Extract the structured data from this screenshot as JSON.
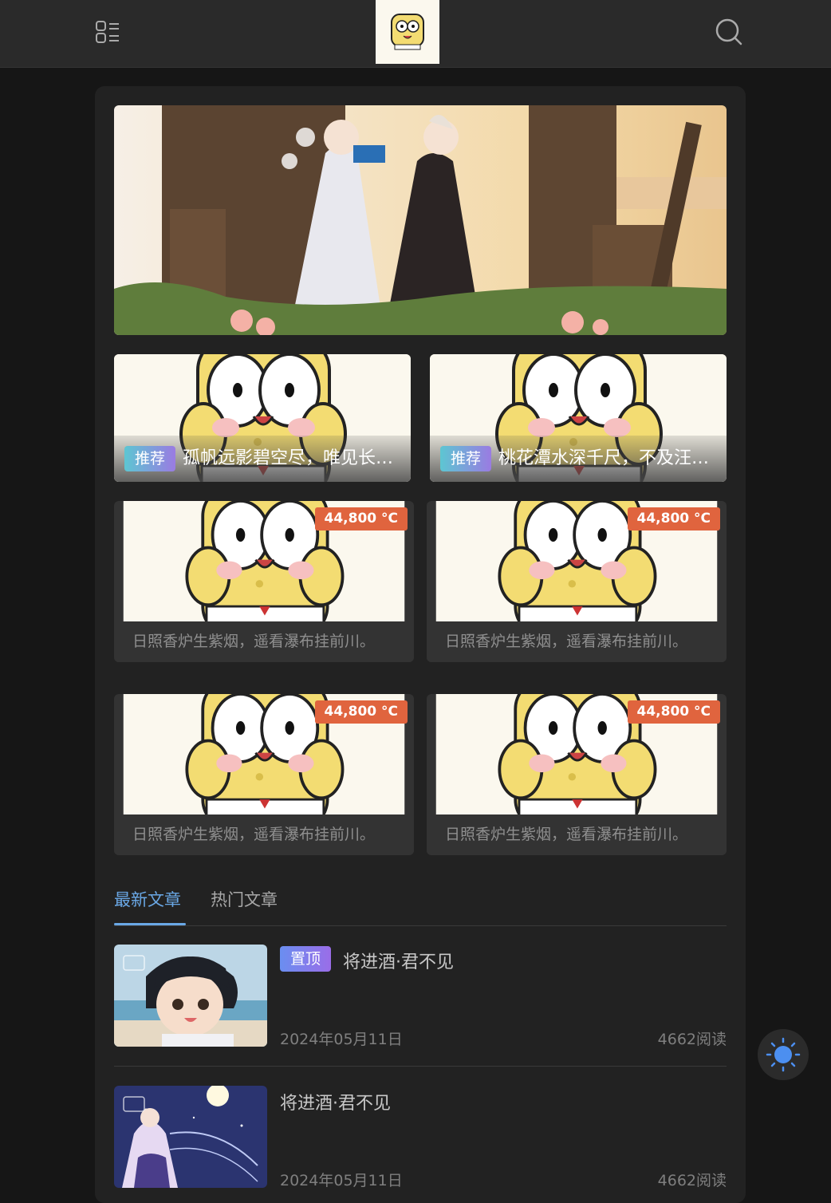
{
  "header": {
    "menu_icon": "menu-grid-icon",
    "logo_icon": "spongebob-logo",
    "search_icon": "search-icon"
  },
  "recommended": [
    {
      "badge": "推荐",
      "title": "孤帆远影碧空尽，唯见长…"
    },
    {
      "badge": "推荐",
      "title": "桃花潭水深千尺，不及汪…"
    }
  ],
  "grid_cards": [
    {
      "temp": "44,800 °C",
      "caption": "日照香炉生紫烟，遥看瀑布挂前川。"
    },
    {
      "temp": "44,800 °C",
      "caption": "日照香炉生紫烟，遥看瀑布挂前川。"
    },
    {
      "temp": "44,800 °C",
      "caption": "日照香炉生紫烟，遥看瀑布挂前川。"
    },
    {
      "temp": "44,800 °C",
      "caption": "日照香炉生紫烟，遥看瀑布挂前川。"
    }
  ],
  "tabs": [
    {
      "label": "最新文章",
      "active": true
    },
    {
      "label": "热门文章",
      "active": false
    }
  ],
  "articles": [
    {
      "pinned": true,
      "badge": "置顶",
      "title": "将进酒·君不见",
      "date": "2024年05月11日",
      "reads": "4662阅读"
    },
    {
      "pinned": false,
      "title": "将进酒·君不见",
      "date": "2024年05月11日",
      "reads": "4662阅读"
    }
  ],
  "theme_toggle_icon": "sun-icon",
  "colors": {
    "accent": "#6aa8e6",
    "temp_badge": "#e0643e",
    "background": "#161616",
    "panel": "#222222"
  }
}
